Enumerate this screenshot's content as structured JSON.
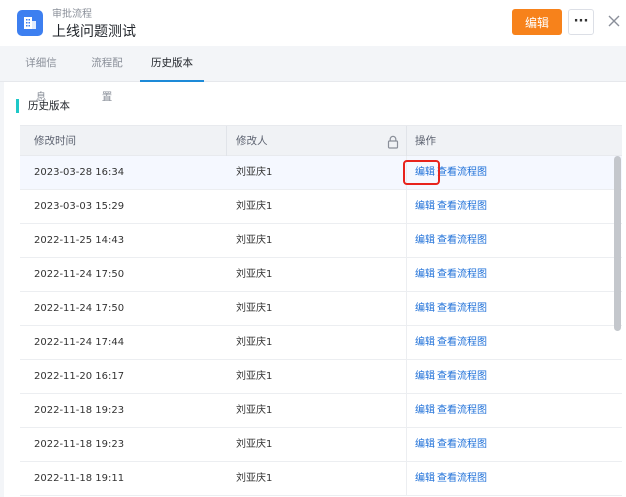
{
  "header": {
    "breadcrumb": "审批流程",
    "title": "上线问题测试",
    "edit_label": "编辑",
    "more_label": "···"
  },
  "tabs": [
    {
      "label": "详细信息",
      "active": false
    },
    {
      "label": "流程配置",
      "active": false
    },
    {
      "label": "历史版本",
      "active": true
    }
  ],
  "section": {
    "title": "历史版本"
  },
  "table": {
    "columns": [
      "修改时间",
      "修改人",
      "操作"
    ],
    "action_edit": "编辑",
    "action_view": "查看流程图",
    "rows": [
      {
        "time": "2023-03-28 16:34",
        "user": "刘亚庆1"
      },
      {
        "time": "2023-03-03 15:29",
        "user": "刘亚庆1"
      },
      {
        "time": "2022-11-25 14:43",
        "user": "刘亚庆1"
      },
      {
        "time": "2022-11-24 17:50",
        "user": "刘亚庆1"
      },
      {
        "time": "2022-11-24 17:50",
        "user": "刘亚庆1"
      },
      {
        "time": "2022-11-24 17:44",
        "user": "刘亚庆1"
      },
      {
        "time": "2022-11-20 16:17",
        "user": "刘亚庆1"
      },
      {
        "time": "2022-11-18 19:23",
        "user": "刘亚庆1"
      },
      {
        "time": "2022-11-18 19:23",
        "user": "刘亚庆1"
      },
      {
        "time": "2022-11-18 19:11",
        "user": "刘亚庆1"
      }
    ]
  },
  "colors": {
    "accent": "#f7821b",
    "link": "#1d6fd8",
    "tab_indicator": "#1d8ad8",
    "section_bar": "#1ec8c8",
    "highlight_box": "#e8231c",
    "app_icon": "#3d7ff0"
  },
  "icons": {
    "app": "building-icon",
    "close": "close-icon",
    "lock": "lock-icon"
  }
}
